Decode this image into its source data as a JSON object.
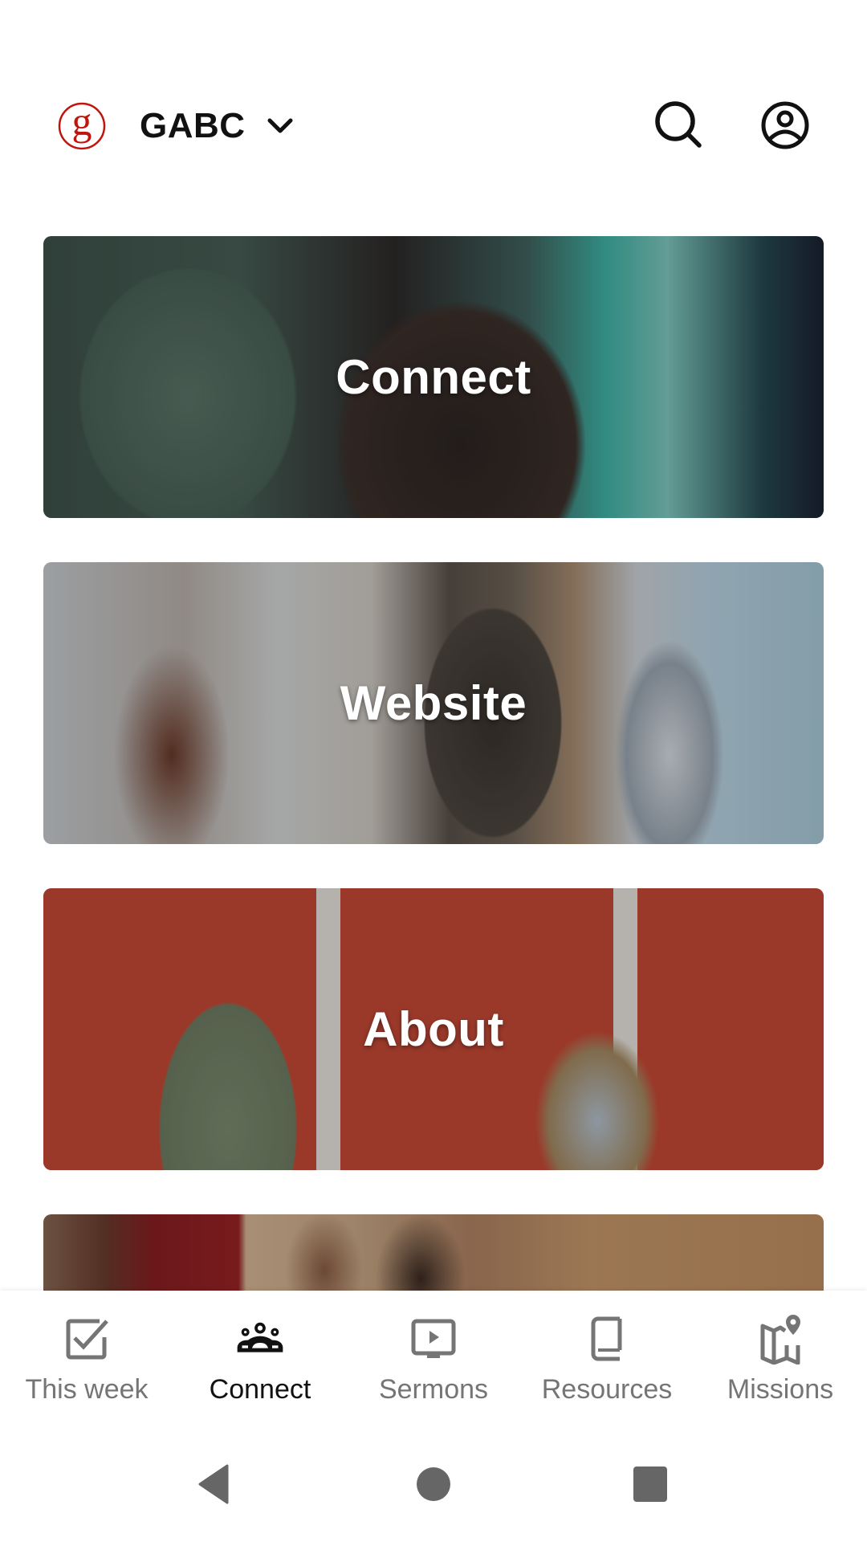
{
  "header": {
    "org_name": "GABC",
    "logo_letter": "g",
    "brand_color": "#C0150C",
    "icons": {
      "logo": "circled-g-logo",
      "org_switch": "chevron-down-icon",
      "search": "search-icon",
      "profile": "account-circle-icon"
    }
  },
  "cards": [
    {
      "title": "Connect"
    },
    {
      "title": "Website"
    },
    {
      "title": "About"
    },
    {
      "title": ""
    }
  ],
  "bottom_nav": {
    "active_index": 1,
    "active_color": "#111111",
    "inactive_color": "#757575",
    "items": [
      {
        "label": "This week",
        "icon": "check-box-icon"
      },
      {
        "label": "Connect",
        "icon": "groups-icon"
      },
      {
        "label": "Sermons",
        "icon": "video-play-icon"
      },
      {
        "label": "Resources",
        "icon": "book-icon"
      },
      {
        "label": "Missions",
        "icon": "map-pin-icon"
      }
    ]
  },
  "system_nav": {
    "icons": [
      "back-icon",
      "home-icon",
      "recents-icon"
    ],
    "color": "#666666"
  }
}
